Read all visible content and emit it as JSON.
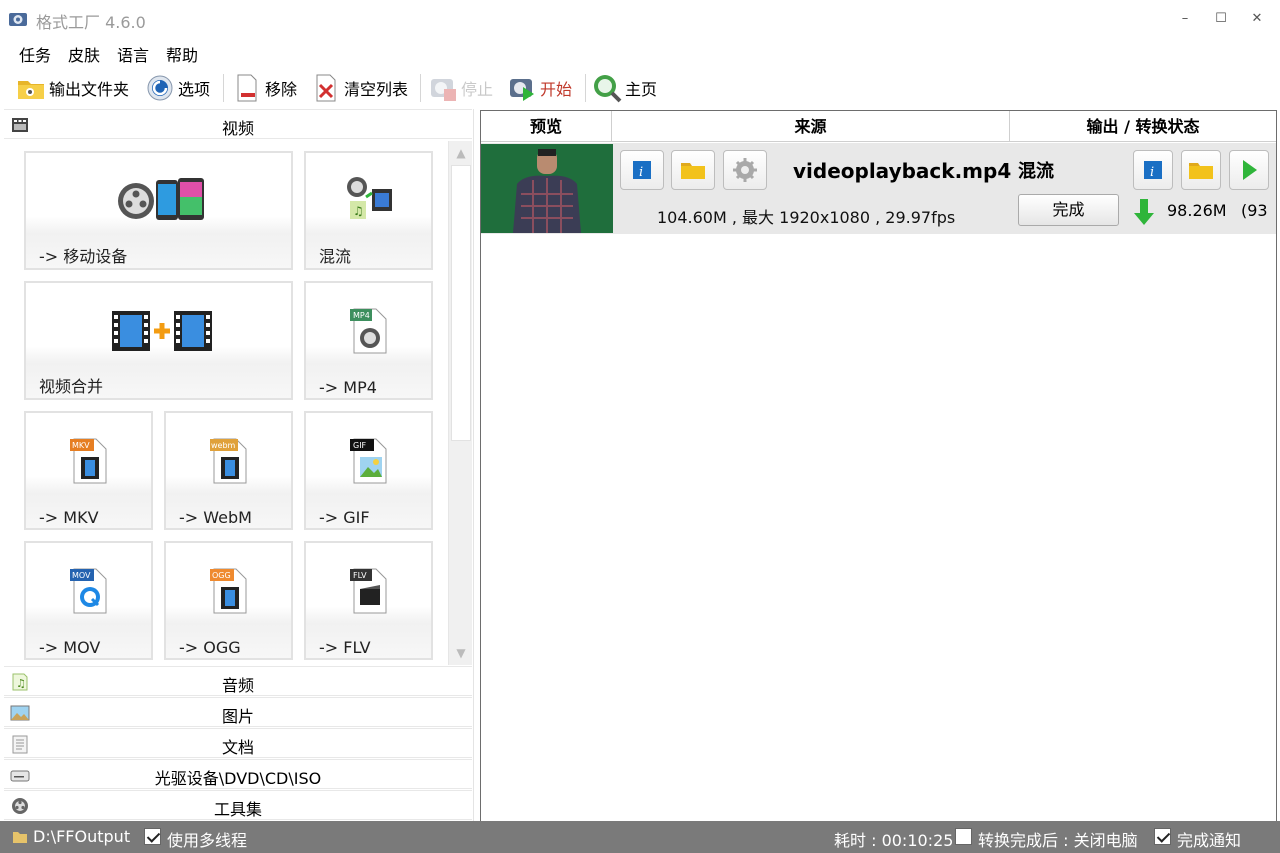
{
  "window": {
    "title": "格式工厂 4.6.0",
    "controls": [
      "–",
      "☐",
      "✕"
    ]
  },
  "menu": [
    "任务",
    "皮肤",
    "语言",
    "帮助"
  ],
  "toolbar": {
    "output_folder": "输出文件夹",
    "options": "选项",
    "remove": "移除",
    "clear_list": "清空列表",
    "stop": "停止",
    "start": "开始",
    "home": "主页"
  },
  "video_section": {
    "title": "视频",
    "tiles": [
      {
        "label": "-> 移动设备"
      },
      {
        "label": "混流"
      },
      {
        "label": "视频合并"
      },
      {
        "label": "-> MP4"
      },
      {
        "label": "-> MKV"
      },
      {
        "label": "-> WebM"
      },
      {
        "label": "-> GIF"
      },
      {
        "label": "-> MOV"
      },
      {
        "label": "-> OGG"
      },
      {
        "label": "-> FLV"
      }
    ],
    "badges": {
      "mp4": "MP4",
      "mkv": "MKV",
      "webm": "webm",
      "gif": "GIF",
      "mov": "MOV",
      "ogg": "OGG",
      "flv": "FLV"
    }
  },
  "categories": [
    "音频",
    "图片",
    "文档",
    "光驱设备\\DVD\\CD\\ISO",
    "工具集"
  ],
  "task_list": {
    "columns": [
      "预览",
      "来源",
      "输出 / 转换状态"
    ],
    "job": {
      "filename": "videoplayback.mp4",
      "info": "104.60M , 最大 1920x1080 , 29.97fps",
      "output_type": "混流",
      "status_button": "完成",
      "output_size": "98.26M",
      "output_ratio": "(93"
    }
  },
  "statusbar": {
    "output_path": "D:\\FFOutput",
    "multithread_label": "使用多线程",
    "multithread_checked": true,
    "elapsed": "耗时 : 00:10:25",
    "shutdown_label": "转换完成后 : 关闭电脑",
    "shutdown_checked": false,
    "notify_label": "完成通知",
    "notify_checked": true
  },
  "colors": {
    "accent_green": "#2fb53a",
    "info_blue": "#1a6fc4",
    "folder_yellow": "#f2c21b",
    "statusbar_gray": "#7a7a7a",
    "start_label": "#c0392b"
  }
}
